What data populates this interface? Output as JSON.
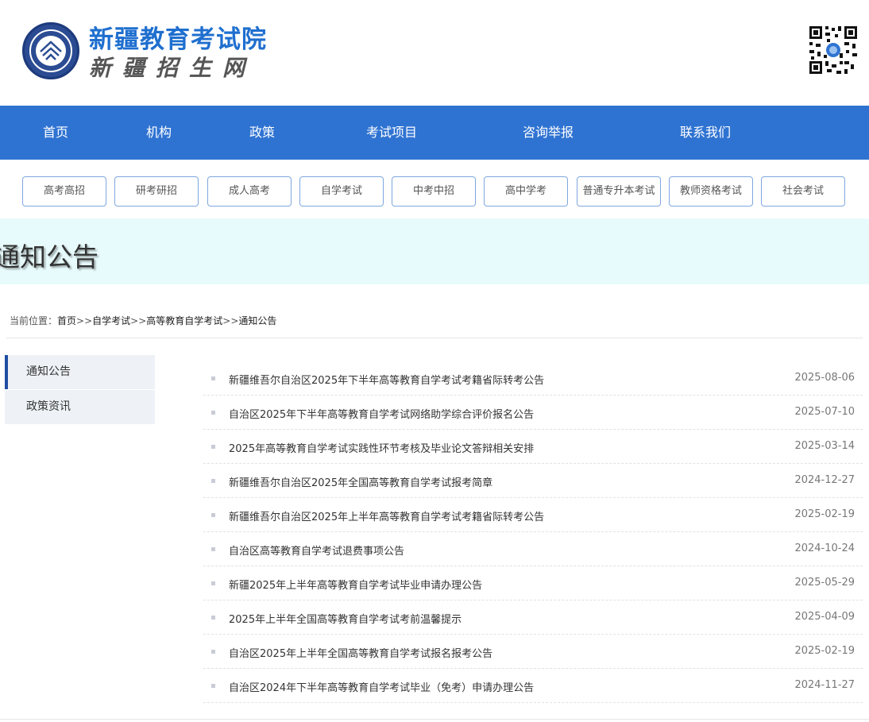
{
  "header": {
    "site_name": "新疆教育考试院",
    "site_subtitle": "新疆招生网",
    "logo_icon": "institute-emblem-icon",
    "qr_icon": "qr-code-icon"
  },
  "nav": {
    "items": [
      {
        "label": "首页"
      },
      {
        "label": "机构"
      },
      {
        "label": "政策"
      },
      {
        "label": "考试项目"
      },
      {
        "label": "咨询举报"
      },
      {
        "label": "联系我们"
      }
    ]
  },
  "categories": [
    {
      "label": "高考高招"
    },
    {
      "label": "研考研招"
    },
    {
      "label": "成人高考"
    },
    {
      "label": "自学考试"
    },
    {
      "label": "中考中招"
    },
    {
      "label": "高中学考"
    },
    {
      "label": "普通专升本考试"
    },
    {
      "label": "教师资格考试"
    },
    {
      "label": "社会考试"
    }
  ],
  "banner": {
    "title": "通知公告"
  },
  "breadcrumb": {
    "label": "当前位置：",
    "items": [
      "首页",
      "自学考试",
      "高等教育自学考试",
      "通知公告"
    ],
    "separator": ">>"
  },
  "sidebar": {
    "items": [
      {
        "label": "通知公告",
        "active": true
      },
      {
        "label": "政策资讯",
        "active": false
      }
    ]
  },
  "notices": [
    {
      "title": "新疆维吾尔自治区2025年下半年高等教育自学考试考籍省际转考公告",
      "date": "2025-08-06"
    },
    {
      "title": "自治区2025年下半年高等教育自学考试网络助学综合评价报名公告",
      "date": "2025-07-10"
    },
    {
      "title": "2025年高等教育自学考试实践性环节考核及毕业论文答辩相关安排",
      "date": "2025-03-14"
    },
    {
      "title": "新疆维吾尔自治区2025年全国高等教育自学考试报考简章",
      "date": "2024-12-27"
    },
    {
      "title": "新疆维吾尔自治区2025年上半年高等教育自学考试考籍省际转考公告",
      "date": "2025-02-19"
    },
    {
      "title": "自治区高等教育自学考试退费事项公告",
      "date": "2024-10-24"
    },
    {
      "title": "新疆2025年上半年高等教育自学考试毕业申请办理公告",
      "date": "2025-05-29"
    },
    {
      "title": "2025年上半年全国高等教育自学考试考前温馨提示",
      "date": "2025-04-09"
    },
    {
      "title": "自治区2025年上半年全国高等教育自学考试报名报考公告",
      "date": "2025-02-19"
    },
    {
      "title": "自治区2024年下半年高等教育自学考试毕业（免考）申请办理公告",
      "date": "2024-11-27"
    }
  ],
  "colors": {
    "nav_bg": "#2f73d2",
    "brand_blue": "#1f6fcf",
    "banner_bg": "#e8fbfc",
    "sidebar_bg": "#eef2f6",
    "active_marker": "#1f4ea3"
  }
}
